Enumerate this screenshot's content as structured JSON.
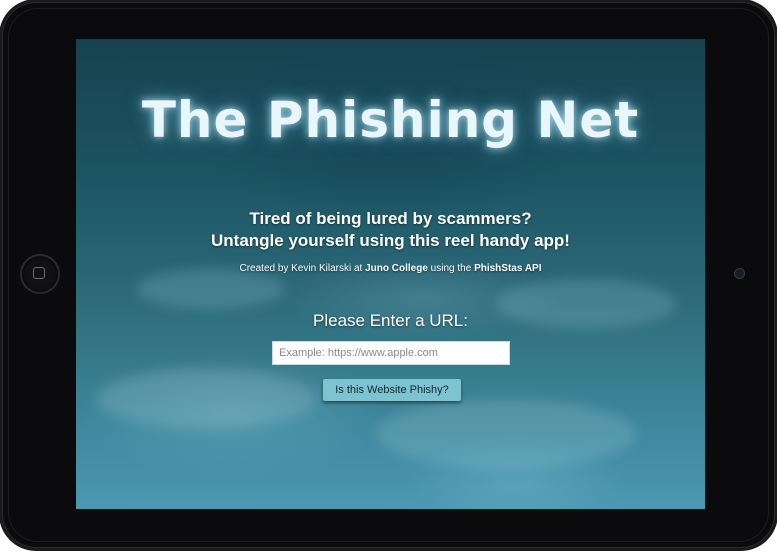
{
  "app": {
    "title": "The Phishing Net",
    "tagline_line1": "Tired of being lured by scammers?",
    "tagline_line2": "Untangle yourself using this reel handy app!",
    "credits": {
      "prefix": "Created by Kevin Kilarski at ",
      "school": "Juno College",
      "middle": " using the ",
      "api": "PhishStas API"
    },
    "url_prompt": "Please Enter a URL:",
    "url_input": {
      "value": "",
      "placeholder": "Example: https://www.apple.com"
    },
    "submit_label": "Is this Website Phishy?"
  },
  "device": {
    "type": "tablet",
    "home_button_icon": "home-square-icon",
    "camera_icon": "camera-icon"
  },
  "colors": {
    "device_body": "#0b0b0d",
    "ocean_dark": "#16424f",
    "ocean_light": "#4a98b2",
    "button_bg": "#7ec4d0",
    "title_glow": "#e9f6fb"
  }
}
